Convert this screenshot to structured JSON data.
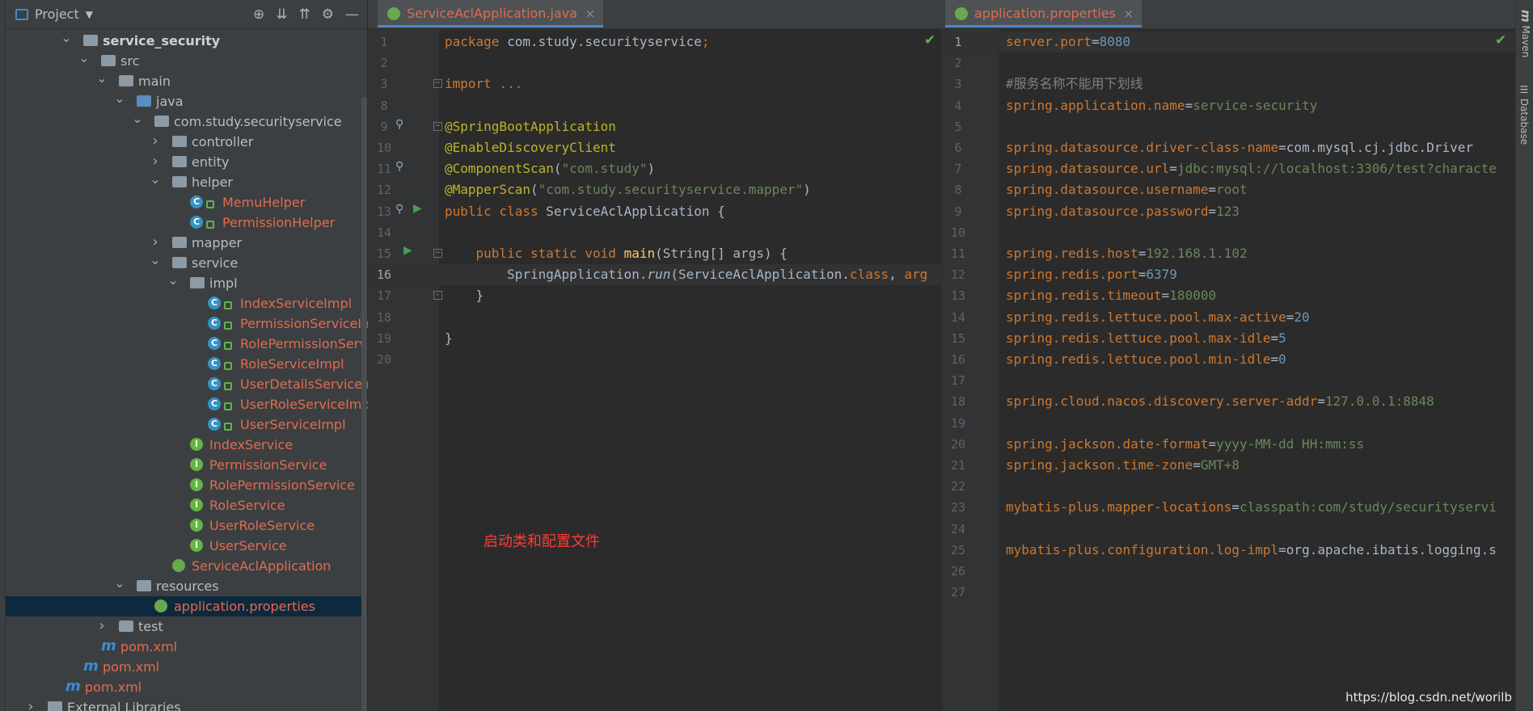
{
  "project": {
    "title": "Project",
    "tree": [
      {
        "label": "service_security",
        "kind": "module",
        "depth": 0,
        "arrow": "open",
        "style": "bold"
      },
      {
        "label": "src",
        "kind": "folder",
        "depth": 1,
        "arrow": "open",
        "style": "white"
      },
      {
        "label": "main",
        "kind": "folder",
        "depth": 2,
        "arrow": "open",
        "style": "white"
      },
      {
        "label": "java",
        "kind": "folder-blue",
        "depth": 3,
        "arrow": "open",
        "style": "white"
      },
      {
        "label": "com.study.securityservice",
        "kind": "folder",
        "depth": 4,
        "arrow": "open",
        "style": "white"
      },
      {
        "label": "controller",
        "kind": "folder",
        "depth": 5,
        "arrow": "closed",
        "style": "white"
      },
      {
        "label": "entity",
        "kind": "folder",
        "depth": 5,
        "arrow": "closed",
        "style": "white"
      },
      {
        "label": "helper",
        "kind": "folder",
        "depth": 5,
        "arrow": "open",
        "style": "white"
      },
      {
        "label": "MemuHelper",
        "kind": "class",
        "depth": 6,
        "arrow": "",
        "style": "red"
      },
      {
        "label": "PermissionHelper",
        "kind": "class",
        "depth": 6,
        "arrow": "",
        "style": "red"
      },
      {
        "label": "mapper",
        "kind": "folder",
        "depth": 5,
        "arrow": "closed",
        "style": "white"
      },
      {
        "label": "service",
        "kind": "folder",
        "depth": 5,
        "arrow": "open",
        "style": "white"
      },
      {
        "label": "impl",
        "kind": "folder",
        "depth": 6,
        "arrow": "open",
        "style": "white"
      },
      {
        "label": "IndexServiceImpl",
        "kind": "class",
        "depth": 7,
        "arrow": "",
        "style": "red"
      },
      {
        "label": "PermissionServiceImpl",
        "kind": "class",
        "depth": 7,
        "arrow": "",
        "style": "red"
      },
      {
        "label": "RolePermissionServiceI",
        "kind": "class",
        "depth": 7,
        "arrow": "",
        "style": "red"
      },
      {
        "label": "RoleServiceImpl",
        "kind": "class",
        "depth": 7,
        "arrow": "",
        "style": "red"
      },
      {
        "label": "UserDetailsServiceImpl",
        "kind": "class",
        "depth": 7,
        "arrow": "",
        "style": "red"
      },
      {
        "label": "UserRoleServiceImpl",
        "kind": "class",
        "depth": 7,
        "arrow": "",
        "style": "red"
      },
      {
        "label": "UserServiceImpl",
        "kind": "class",
        "depth": 7,
        "arrow": "",
        "style": "red"
      },
      {
        "label": "IndexService",
        "kind": "interface",
        "depth": 6,
        "arrow": "",
        "style": "red"
      },
      {
        "label": "PermissionService",
        "kind": "interface",
        "depth": 6,
        "arrow": "",
        "style": "red"
      },
      {
        "label": "RolePermissionService",
        "kind": "interface",
        "depth": 6,
        "arrow": "",
        "style": "red"
      },
      {
        "label": "RoleService",
        "kind": "interface",
        "depth": 6,
        "arrow": "",
        "style": "red"
      },
      {
        "label": "UserRoleService",
        "kind": "interface",
        "depth": 6,
        "arrow": "",
        "style": "red"
      },
      {
        "label": "UserService",
        "kind": "interface",
        "depth": 6,
        "arrow": "",
        "style": "red"
      },
      {
        "label": "ServiceAclApplication",
        "kind": "spring",
        "depth": 5,
        "arrow": "",
        "style": "red"
      },
      {
        "label": "resources",
        "kind": "folder",
        "depth": 3,
        "arrow": "open",
        "style": "white"
      },
      {
        "label": "application.properties",
        "kind": "spring",
        "depth": 4,
        "arrow": "",
        "style": "red",
        "selected": true
      },
      {
        "label": "test",
        "kind": "folder",
        "depth": 2,
        "arrow": "closed",
        "style": "white"
      },
      {
        "label": "pom.xml",
        "kind": "maven",
        "depth": 1,
        "arrow": "",
        "style": "red"
      },
      {
        "label": "pom.xml",
        "kind": "maven",
        "depth": 0,
        "arrow": "",
        "style": "red"
      },
      {
        "label": "pom.xml",
        "kind": "maven",
        "depth": -1,
        "arrow": "",
        "style": "red"
      },
      {
        "label": "External Libraries",
        "kind": "libs",
        "depth": -2,
        "arrow": "closed",
        "style": "white"
      }
    ]
  },
  "editor_java": {
    "tab_label": "ServiceAclApplication.java",
    "tab_close": "×",
    "line_numbers": [
      "1",
      "2",
      "3",
      "8",
      "9",
      "10",
      "11",
      "12",
      "13",
      "14",
      "15",
      "16",
      "17",
      "18",
      "19",
      "20"
    ],
    "lines": [
      [
        [
          "kw",
          "package "
        ],
        [
          "pl",
          "com.study.securityservice"
        ],
        [
          "kw",
          ";"
        ]
      ],
      [],
      [
        [
          "kw",
          "import "
        ],
        [
          "cmt",
          "..."
        ]
      ],
      [],
      [
        [
          "ann",
          "@SpringBootApplication"
        ]
      ],
      [
        [
          "ann",
          "@EnableDiscoveryClient"
        ]
      ],
      [
        [
          "ann",
          "@ComponentScan"
        ],
        [
          "pl",
          "("
        ],
        [
          "str",
          "\"com.study\""
        ],
        [
          "pl",
          ")"
        ]
      ],
      [
        [
          "ann",
          "@MapperScan"
        ],
        [
          "pl",
          "("
        ],
        [
          "str",
          "\"com.study.securityservice.mapper\""
        ],
        [
          "pl",
          ")"
        ]
      ],
      [
        [
          "kw",
          "public class "
        ],
        [
          "pl",
          "ServiceAclApplication {"
        ]
      ],
      [],
      [
        [
          "pl",
          "    "
        ],
        [
          "kw",
          "public static void "
        ],
        [
          "fn",
          "main"
        ],
        [
          "pl",
          "(String[] args) {"
        ]
      ],
      [
        [
          "pl",
          "        SpringApplication."
        ],
        [
          "it",
          "run"
        ],
        [
          "pl",
          "(ServiceAclApplication."
        ],
        [
          "kw",
          "class"
        ],
        [
          "pl",
          ", "
        ],
        [
          "kw",
          "arg"
        ]
      ],
      [
        [
          "pl",
          "    }"
        ]
      ],
      [],
      [
        [
          "pl",
          "}"
        ]
      ],
      []
    ]
  },
  "editor_props": {
    "tab_label": "application.properties",
    "tab_close": "×",
    "lines": [
      [
        [
          "pk",
          "server.port"
        ],
        [
          "pl",
          "="
        ],
        [
          "num",
          "8080"
        ]
      ],
      [],
      [
        [
          "cmt",
          "#服务名称不能用下划线"
        ]
      ],
      [
        [
          "pk",
          "spring.application.name"
        ],
        [
          "pl",
          "="
        ],
        [
          "pv",
          "service-security"
        ]
      ],
      [],
      [
        [
          "pk",
          "spring.datasource.driver-class-name"
        ],
        [
          "pl",
          "="
        ],
        [
          "pl",
          "com.mysql.cj.jdbc.Driver"
        ]
      ],
      [
        [
          "pk",
          "spring.datasource.url"
        ],
        [
          "pl",
          "="
        ],
        [
          "pv",
          "jdbc:mysql://localhost:3306/test?characte"
        ]
      ],
      [
        [
          "pk",
          "spring.datasource.username"
        ],
        [
          "pl",
          "="
        ],
        [
          "pv",
          "root"
        ]
      ],
      [
        [
          "pk",
          "spring.datasource.password"
        ],
        [
          "pl",
          "="
        ],
        [
          "pv",
          "123"
        ]
      ],
      [],
      [
        [
          "pk",
          "spring.redis.host"
        ],
        [
          "pl",
          "="
        ],
        [
          "pv",
          "192.168.1.102"
        ]
      ],
      [
        [
          "pk",
          "spring.redis.port"
        ],
        [
          "pl",
          "="
        ],
        [
          "num",
          "6379"
        ]
      ],
      [
        [
          "pk",
          "spring.redis.timeout"
        ],
        [
          "pl",
          "="
        ],
        [
          "pv",
          "180000"
        ]
      ],
      [
        [
          "pk",
          "spring.redis.lettuce.pool.max-active"
        ],
        [
          "pl",
          "="
        ],
        [
          "num",
          "20"
        ]
      ],
      [
        [
          "pk",
          "spring.redis.lettuce.pool.max-idle"
        ],
        [
          "pl",
          "="
        ],
        [
          "num",
          "5"
        ]
      ],
      [
        [
          "pk",
          "spring.redis.lettuce.pool.min-idle"
        ],
        [
          "pl",
          "="
        ],
        [
          "num",
          "0"
        ]
      ],
      [],
      [
        [
          "pk",
          "spring.cloud.nacos.discovery.server-addr"
        ],
        [
          "pl",
          "="
        ],
        [
          "pv",
          "127.0.0.1:8848"
        ]
      ],
      [],
      [
        [
          "pk",
          "spring.jackson.date-format"
        ],
        [
          "pl",
          "="
        ],
        [
          "pv",
          "yyyy-MM-dd HH:mm:ss"
        ]
      ],
      [
        [
          "pk",
          "spring.jackson.time-zone"
        ],
        [
          "pl",
          "="
        ],
        [
          "pv",
          "GMT+8"
        ]
      ],
      [],
      [
        [
          "pk",
          "mybatis-plus.mapper-locations"
        ],
        [
          "pl",
          "="
        ],
        [
          "pv",
          "classpath:com/study/securityservi"
        ]
      ],
      [],
      [
        [
          "pk",
          "mybatis-plus.configuration.log-impl"
        ],
        [
          "pl",
          "="
        ],
        [
          "pl",
          "org.apache.ibatis.logging.s"
        ]
      ],
      [],
      []
    ]
  },
  "right_strip": {
    "maven": "Maven",
    "database": "Database"
  },
  "caption": "启动类和配置文件",
  "watermark": "https://blog.csdn.net/worilb"
}
